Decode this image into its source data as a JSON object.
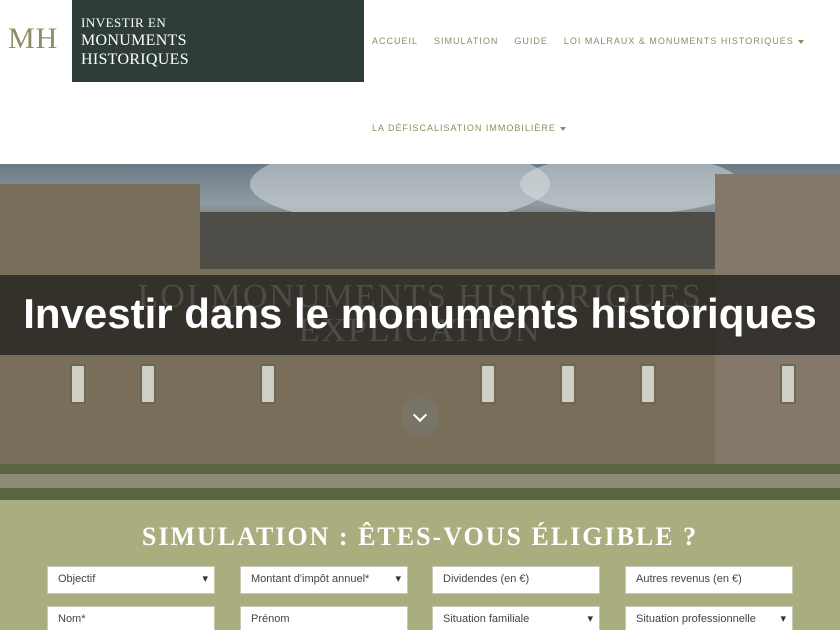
{
  "header": {
    "logo_mark": "MH",
    "logo_line1": "INVESTIR EN",
    "logo_line2": "MONUMENTS",
    "logo_line3": "HISTORIQUES",
    "nav": [
      {
        "label": "ACCUEIL"
      },
      {
        "label": "SIMULATION"
      },
      {
        "label": "GUIDE"
      },
      {
        "label": "LOI MALRAUX & MONUMENTS HISTORIQUES",
        "icon": "caret-down-icon"
      },
      {
        "label": "LA DÉFISCALISATION IMMOBILIÈRE",
        "icon": "caret-down-icon"
      }
    ]
  },
  "hero": {
    "bg_text_line1": "LOI MONUMENTS HISTORIQUES",
    "bg_text_line2": "EXPLICATION",
    "title": "Investir dans le monuments historiques",
    "scroll_icon": "chevron-down-icon"
  },
  "simulation": {
    "title": "SIMULATION : ÊTES-VOUS ÉLIGIBLE ?",
    "fields_row1": [
      {
        "label": "Objectif",
        "type": "select"
      },
      {
        "label": "Montant d'impôt annuel*",
        "type": "select"
      },
      {
        "label": "Dividendes (en €)",
        "type": "input"
      },
      {
        "label": "Autres revenus (en €)",
        "type": "input"
      }
    ],
    "fields_row2": [
      {
        "label": "Nom*",
        "type": "input"
      },
      {
        "label": "Prénom",
        "type": "input"
      },
      {
        "label": "Situation familiale",
        "type": "select"
      },
      {
        "label": "Situation professionnelle",
        "type": "select"
      }
    ]
  },
  "colors": {
    "logo_box": "#2f3d37",
    "nav_text": "#8d8e5e",
    "sim_background": "#aaad7d"
  }
}
